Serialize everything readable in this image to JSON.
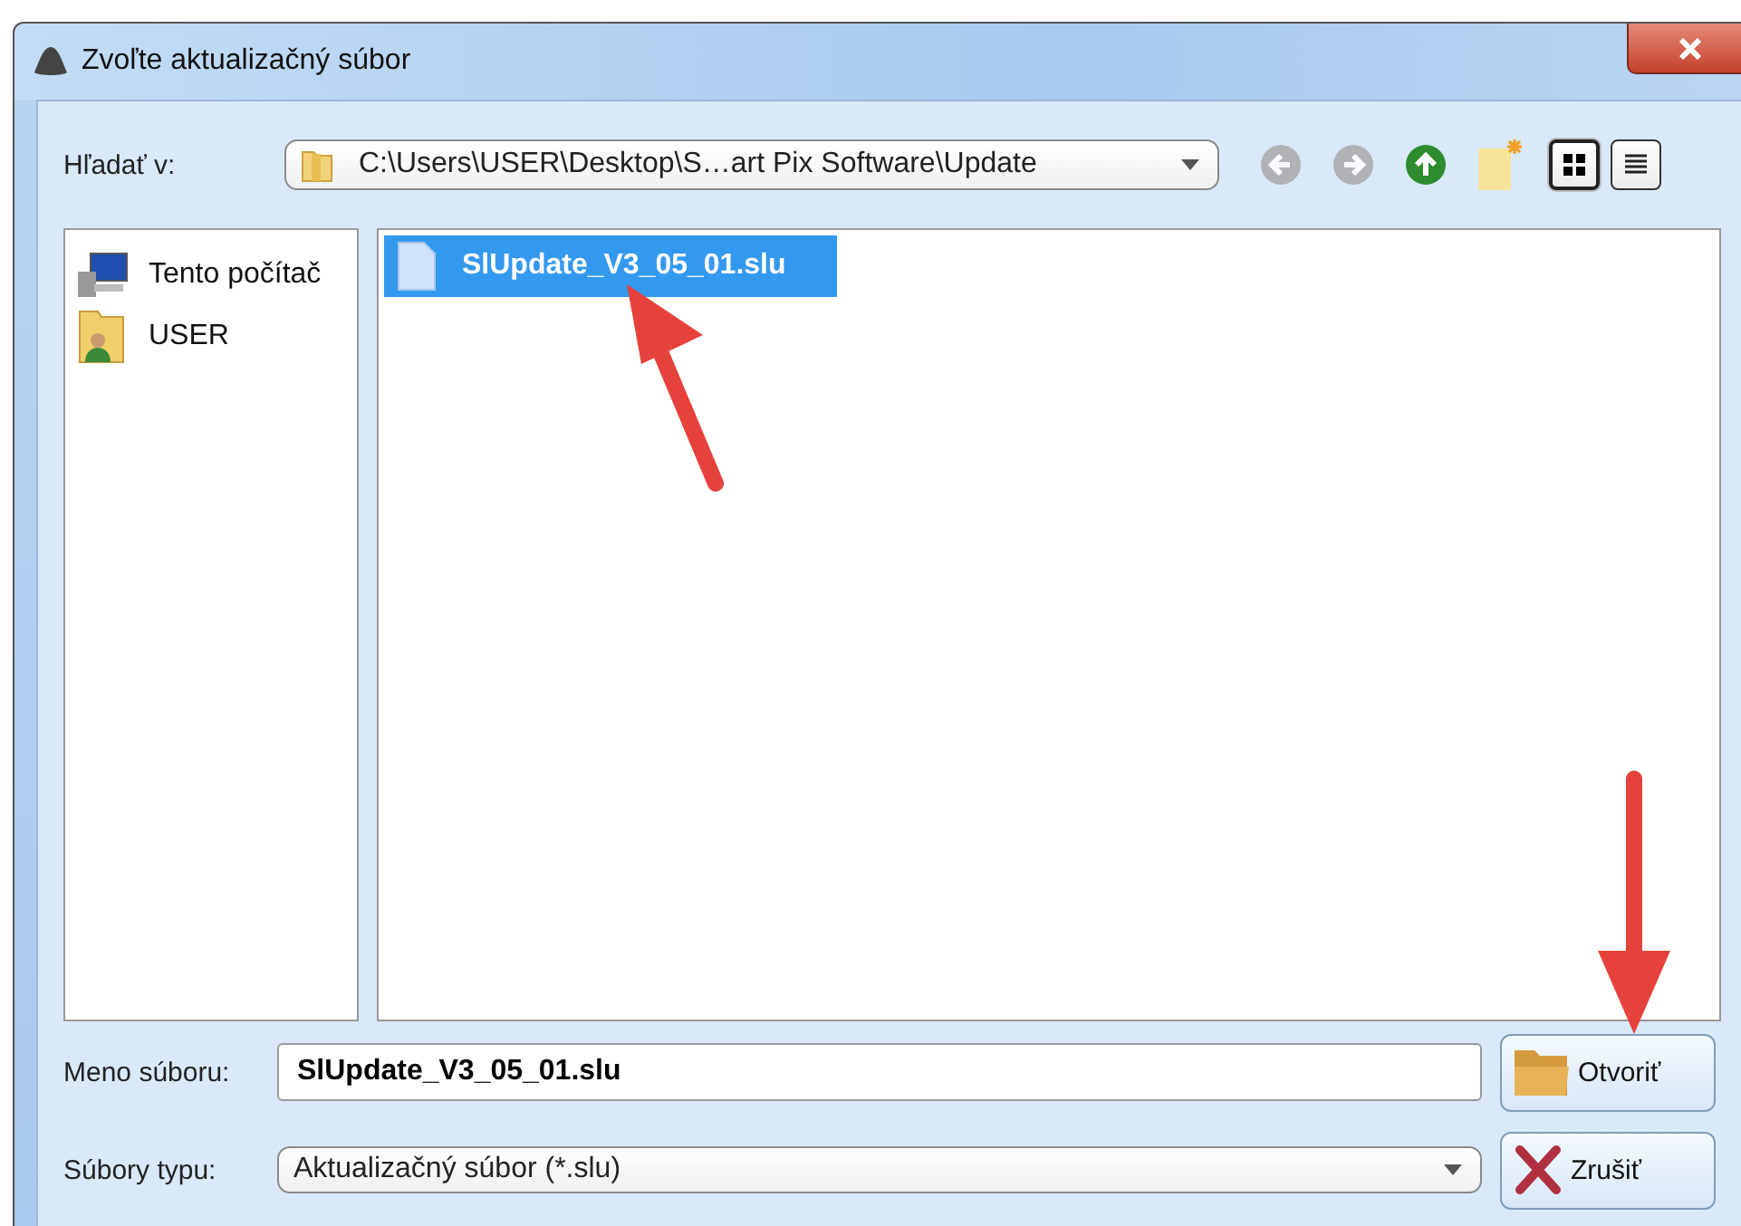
{
  "window": {
    "title": "Zvoľte aktualizačný súbor"
  },
  "look_in": {
    "label": "Hľadať v:",
    "path": "C:\\Users\\USER\\Desktop\\S…art Pix Software\\Update"
  },
  "toolbar": [
    {
      "kind": "back",
      "disabled": true
    },
    {
      "kind": "forward",
      "disabled": true
    },
    {
      "kind": "up",
      "disabled": false
    },
    {
      "kind": "new-folder",
      "disabled": false
    }
  ],
  "views": [
    {
      "kind": "icons",
      "selected": true
    },
    {
      "kind": "details",
      "selected": false
    }
  ],
  "places": [
    {
      "kind": "computer",
      "label": "Tento počítač"
    },
    {
      "kind": "user",
      "label": "USER"
    }
  ],
  "files": [
    {
      "name": "SlUpdate_V3_05_01.slu",
      "selected": true
    }
  ],
  "file_name": {
    "label": "Meno súboru:",
    "value": "SlUpdate_V3_05_01.slu"
  },
  "file_type": {
    "label": "Súbory typu:",
    "value": "Aktualizačný súbor (*.slu)"
  },
  "buttons": [
    {
      "kind": "open",
      "label": "Otvoriť"
    },
    {
      "kind": "cancel",
      "label": "Zrušiť"
    }
  ]
}
